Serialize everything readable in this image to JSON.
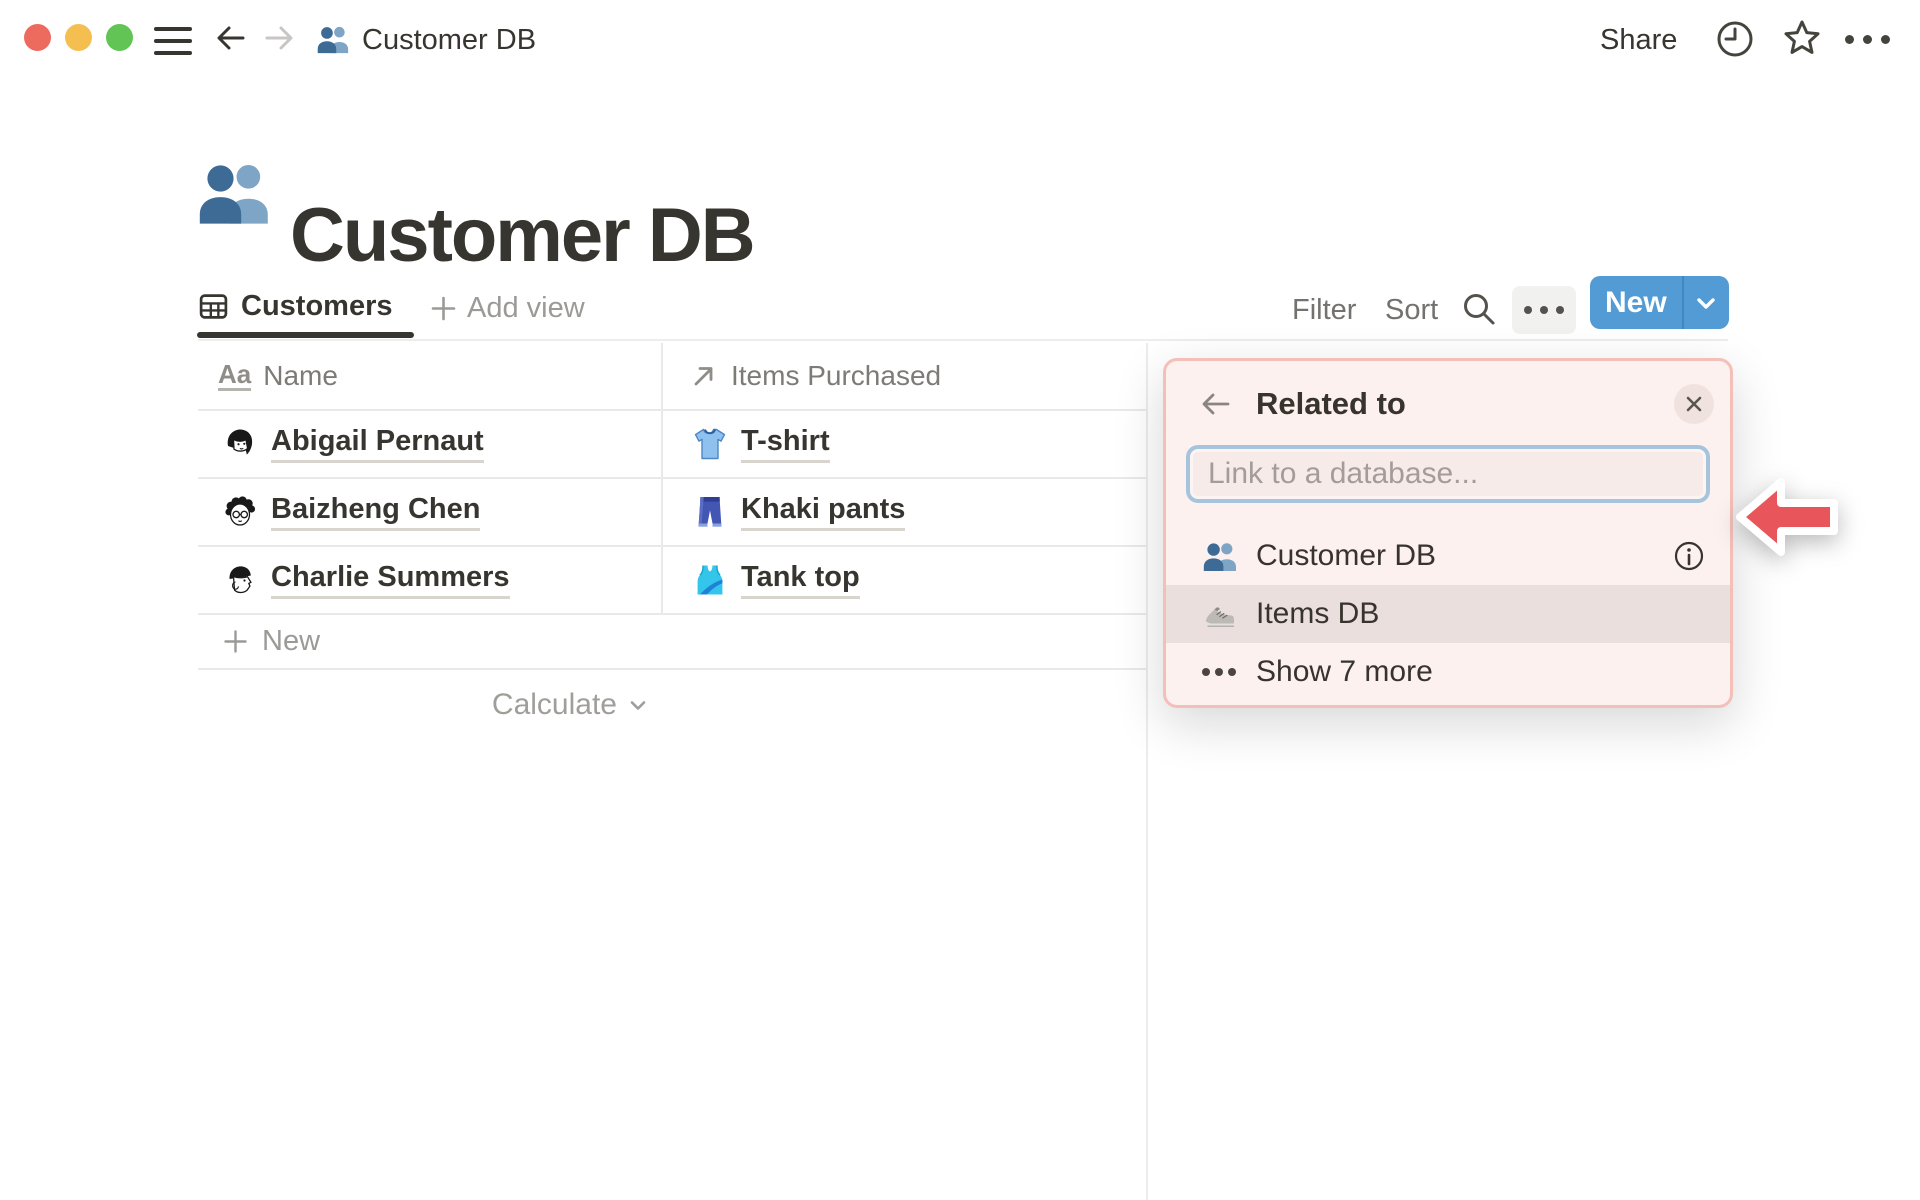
{
  "window": {
    "traffic_lights": [
      "close",
      "minimize",
      "zoom"
    ]
  },
  "topbar": {
    "breadcrumb_icon": "people-icon",
    "breadcrumb_title": "Customer DB",
    "share_label": "Share",
    "right_icons": [
      "clock-icon",
      "star-icon",
      "ellipsis-icon"
    ]
  },
  "page": {
    "icon": "people-icon",
    "title": "Customer DB"
  },
  "view_bar": {
    "active_view_icon": "table-view-icon",
    "active_view": "Customers",
    "add_view_label": "Add view",
    "filter_label": "Filter",
    "sort_label": "Sort",
    "new_label": "New"
  },
  "table": {
    "columns": [
      {
        "icon": "text-property-icon",
        "label": "Name"
      },
      {
        "icon": "relation-property-icon",
        "label": "Items Purchased"
      }
    ],
    "rows": [
      {
        "avatar": "avatar-abigail",
        "name": "Abigail Pernaut",
        "item_icon": "tshirt-icon",
        "item": "T-shirt"
      },
      {
        "avatar": "avatar-baizheng",
        "name": "Baizheng Chen",
        "item_icon": "jeans-icon",
        "item": "Khaki pants"
      },
      {
        "avatar": "avatar-charlie",
        "name": "Charlie Summers",
        "item_icon": "tanktop-icon",
        "item": "Tank top"
      }
    ],
    "new_row_label": "New",
    "calculate_label": "Calculate"
  },
  "popup": {
    "title": "Related to",
    "search_placeholder": "Link to a database...",
    "options": [
      {
        "icon": "people-icon",
        "label": "Customer DB",
        "trailing_icon": "info-icon",
        "highlighted": false
      },
      {
        "icon": "sneaker-icon",
        "label": "Items DB",
        "highlighted": true
      },
      {
        "icon": "more-dots-icon",
        "label": "Show 7 more",
        "highlighted": false
      }
    ]
  },
  "colors": {
    "accent_blue": "#539BD5",
    "popup_bg": "#FCF1EF",
    "popup_border": "#F3BFB9",
    "highlight_row": "#EBDFDD",
    "input_focus_blue": "#A6C5DD",
    "arrow_red": "#E8555A",
    "traffic_red": "#EC6A5E",
    "traffic_yellow": "#F4BF50",
    "traffic_green": "#61C454",
    "text_dark": "#37352F",
    "text_gray": "#9B9A97",
    "divider": "#E9E9E7"
  }
}
